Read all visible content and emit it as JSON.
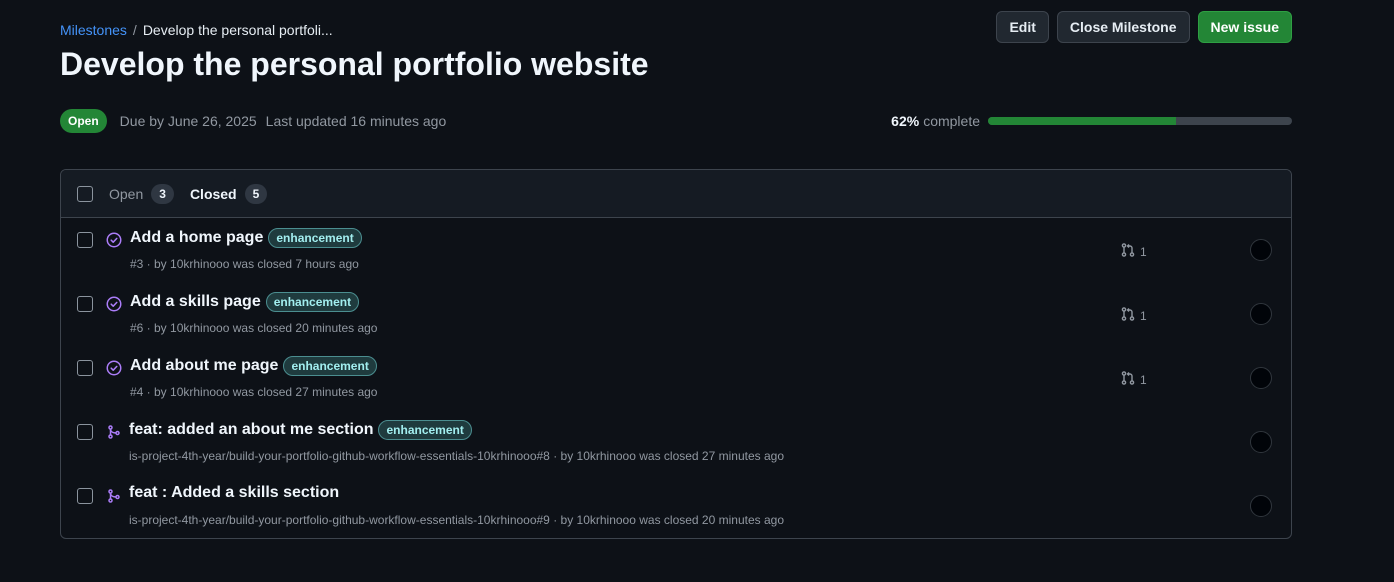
{
  "breadcrumb": {
    "parent": "Milestones",
    "separator": "/",
    "current": "Develop the personal portfoli..."
  },
  "actions": {
    "edit": "Edit",
    "close": "Close Milestone",
    "new_issue": "New issue"
  },
  "title": "Develop the personal portfolio website",
  "meta": {
    "status": "Open",
    "due": "Due by June 26, 2025",
    "updated": "Last updated 16 minutes ago"
  },
  "progress": {
    "percent_label": "62%",
    "complete_label": "complete",
    "value": 0.62
  },
  "tabs": {
    "open_label": "Open",
    "open_count": "3",
    "closed_label": "Closed",
    "closed_count": "5"
  },
  "items": [
    {
      "title": "Add a home page",
      "label": "enhancement",
      "sub": "#3 · by 10krhinooo was closed 7 hours ago",
      "prs": "1",
      "type": "issue"
    },
    {
      "title": "Add a skills page",
      "label": "enhancement",
      "sub": "#6 · by 10krhinooo was closed 20 minutes ago",
      "prs": "1",
      "type": "issue"
    },
    {
      "title": "Add about me page",
      "label": "enhancement",
      "sub": "#4 · by 10krhinooo was closed 27 minutes ago",
      "prs": "1",
      "type": "issue"
    },
    {
      "title": "feat: added an about me section",
      "label": "enhancement",
      "sub": "is-project-4th-year/build-your-portfolio-github-workflow-essentials-10krhinooo#8 · by 10krhinooo was closed 27 minutes ago",
      "prs": "",
      "type": "pr"
    },
    {
      "title": "feat : Added a skills section",
      "label": "",
      "sub": "is-project-4th-year/build-your-portfolio-github-workflow-essentials-10krhinooo#9 · by 10krhinooo was closed 20 minutes ago",
      "prs": "",
      "type": "pr"
    }
  ],
  "icons": {
    "closed_issue": "issue-closed-icon",
    "merged_pr": "git-merge-icon",
    "linked_pr": "git-pull-request-icon"
  },
  "colors": {
    "accent": "#4493f8",
    "success": "#238636",
    "done_purple": "#ab7df8",
    "label_text": "#a2eeef"
  }
}
